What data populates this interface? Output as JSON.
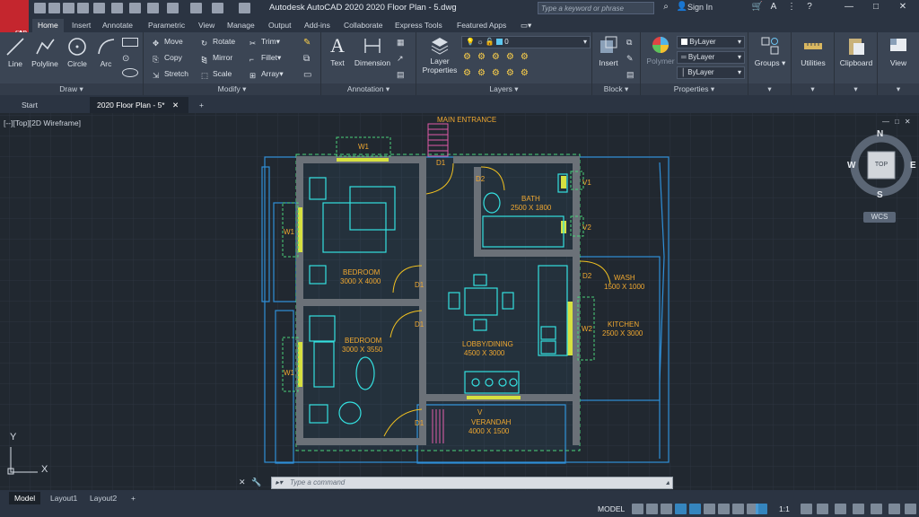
{
  "app": {
    "logo_letter": "A",
    "logo_sub": "CAD",
    "title": "Autodesk AutoCAD 2020    2020 Floor Plan - 5.dwg",
    "search_placeholder": "Type a keyword or phrase",
    "sign_in": "Sign In"
  },
  "ribbon_tabs": [
    "Home",
    "Insert",
    "Annotate",
    "Parametric",
    "View",
    "Manage",
    "Output",
    "Add-ins",
    "Collaborate",
    "Express Tools",
    "Featured Apps"
  ],
  "ribbon": {
    "draw": {
      "title": "Draw",
      "line": "Line",
      "polyline": "Polyline",
      "circle": "Circle",
      "arc": "Arc"
    },
    "modify": {
      "title": "Modify",
      "move": "Move",
      "rotate": "Rotate",
      "trim": "Trim",
      "copy": "Copy",
      "mirror": "Mirror",
      "fillet": "Fillet",
      "stretch": "Stretch",
      "scale": "Scale",
      "array": "Array"
    },
    "annotation": {
      "title": "Annotation",
      "text": "Text",
      "dimension": "Dimension"
    },
    "layers": {
      "title": "Layers",
      "layer_properties": "Layer Properties",
      "current_layer": "0"
    },
    "block": {
      "title": "Block",
      "insert": "Insert"
    },
    "properties": {
      "title": "Properties",
      "match": "Polymer",
      "color": "ByLayer",
      "linetype": "ByLayer",
      "lineweight": "ByLayer"
    },
    "groups": "Groups",
    "utilities": "Utilities",
    "clipboard": "Clipboard",
    "view": "View"
  },
  "doc_tabs": {
    "start": "Start",
    "current": "2020 Floor Plan - 5*"
  },
  "viewport_label": "[--][Top][2D Wireframe]",
  "viewcube": {
    "n": "N",
    "s": "S",
    "e": "E",
    "w": "W",
    "face": "TOP",
    "wcs": "WCS"
  },
  "floorplan": {
    "main_entrance": "MAIN ENTRANCE",
    "bath": "BATH",
    "bath_dim": "2500 X 1800",
    "bedroom1": "BEDROOM",
    "bedroom1_dim": "3000 X 4000",
    "bedroom2": "BEDROOM",
    "bedroom2_dim": "3000 X 3550",
    "wash": "WASH",
    "wash_dim": "1500 X 1000",
    "kitchen": "KITCHEN",
    "kitchen_dim": "2500 X 3000",
    "lobby": "LOBBY/DINING",
    "lobby_dim": "4500 X 3000",
    "verandah": "VERANDAH",
    "verandah_dim": "4000 X 1500",
    "v_label": "V",
    "w1": "W1",
    "w2": "W2",
    "d1": "D1",
    "d2": "D2",
    "v1": "V1",
    "v2": "V2",
    "ucs_x": "X",
    "ucs_y": "Y"
  },
  "command": {
    "placeholder": "Type a command"
  },
  "status": {
    "model_tab": "Model",
    "layout1": "Layout1",
    "layout2": "Layout2",
    "add": "+",
    "model_label": "MODEL",
    "scale": "1:1"
  }
}
